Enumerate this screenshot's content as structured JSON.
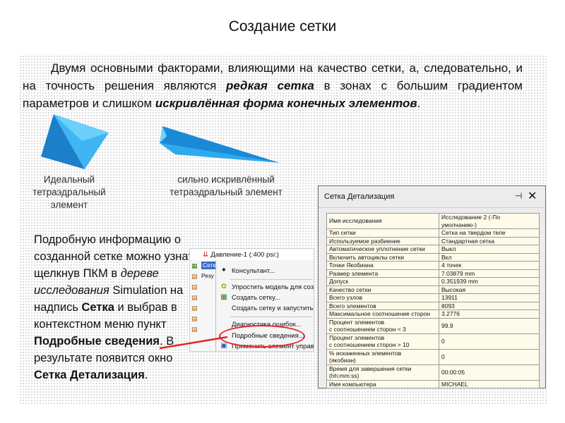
{
  "page": {
    "title": "Создание сетки",
    "intro": {
      "p1": "Двумя основными факторами, влияющими на качество сетки, а, следовательно, и на точность решения являются ",
      "em1": "редкая сетка",
      "p2": " в зонах с большим градиентом параметров и слишком ",
      "em2": "искривлённая форма конечных элементов",
      "p3": "."
    },
    "captions": {
      "ideal": "Идеальный тетраэдральный элемент",
      "distorted": "сильно искривлённый тетраэдральный элемент"
    },
    "paragraph": {
      "t1": "Подробную информацию о созданной сетке можно узнать, щелкнув ПКМ в ",
      "i1": "дереве исследования",
      "t2": " Simulation на надпись ",
      "b1": "Сетка",
      "t3": " и выбрав в контекстном меню пункт ",
      "b2": "Подробные сведения",
      "t4": ". В результате появится окно ",
      "b3": "Сетка Детализация",
      "t5": "."
    },
    "colors": {
      "accent": "#e32424",
      "tetra": "#2aa3e8",
      "dialog_bg": "#fffbea"
    }
  },
  "context_menu": {
    "study_label": "Давление-1 (:400 psi:)",
    "selected_node": "Сетка",
    "partial_node": "Резу",
    "items": [
      {
        "label": "Консультант...",
        "icon": "wizard-icon"
      },
      {
        "label": "Упростить модель для созд",
        "icon": "simplify-icon"
      },
      {
        "label": "Создать сетку...",
        "icon": "mesh-create-icon"
      },
      {
        "label": "Создать сетку и запустить",
        "icon": ""
      },
      {
        "label": "Диагностика ошибок...",
        "icon": ""
      },
      {
        "label": "Подробные сведения...",
        "icon": ""
      },
      {
        "label": "Применить элемент управл",
        "icon": "mesh-control-icon"
      }
    ]
  },
  "dialog": {
    "title": "Сетка Детализация",
    "rows": [
      {
        "k": "Имя исследования",
        "v": "Исследование 2 (-По умолчанию-)"
      },
      {
        "k": "Тип сетки",
        "v": "Сетка на твердом теле"
      },
      {
        "k": "Используемое разбиение",
        "v": "Стандартная сетка"
      },
      {
        "k": "Автоматическое уплотнение сетки",
        "v": "Выкл"
      },
      {
        "k": "Включить автоциклы сетки",
        "v": "Вкл"
      },
      {
        "k": "Точки Якобиана",
        "v": "4 точек"
      },
      {
        "k": "Размер элемента",
        "v": "7.03879 mm"
      },
      {
        "k": "Допуск",
        "v": "0.351939 mm"
      },
      {
        "k": "Качество сетки",
        "v": "Высокая"
      },
      {
        "k": "Всего узлов",
        "v": "13911"
      },
      {
        "k": "Всего элементов",
        "v": "8093"
      },
      {
        "k": "Максимальное соотношение сторон",
        "v": "3.2776"
      },
      {
        "k": "Процент элементов\nс соотношением сторон < 3",
        "v": "99.9"
      },
      {
        "k": "Процент элементов\nс соотношением сторон > 10",
        "v": "0"
      },
      {
        "k": "% искаженных элементов\n(якобиан)",
        "v": "0"
      },
      {
        "k": "Время для завершения сетки (hh:mm:ss)",
        "v": "00:00:05"
      },
      {
        "k": "Имя компьютера",
        "v": "MICHAEL"
      }
    ]
  }
}
